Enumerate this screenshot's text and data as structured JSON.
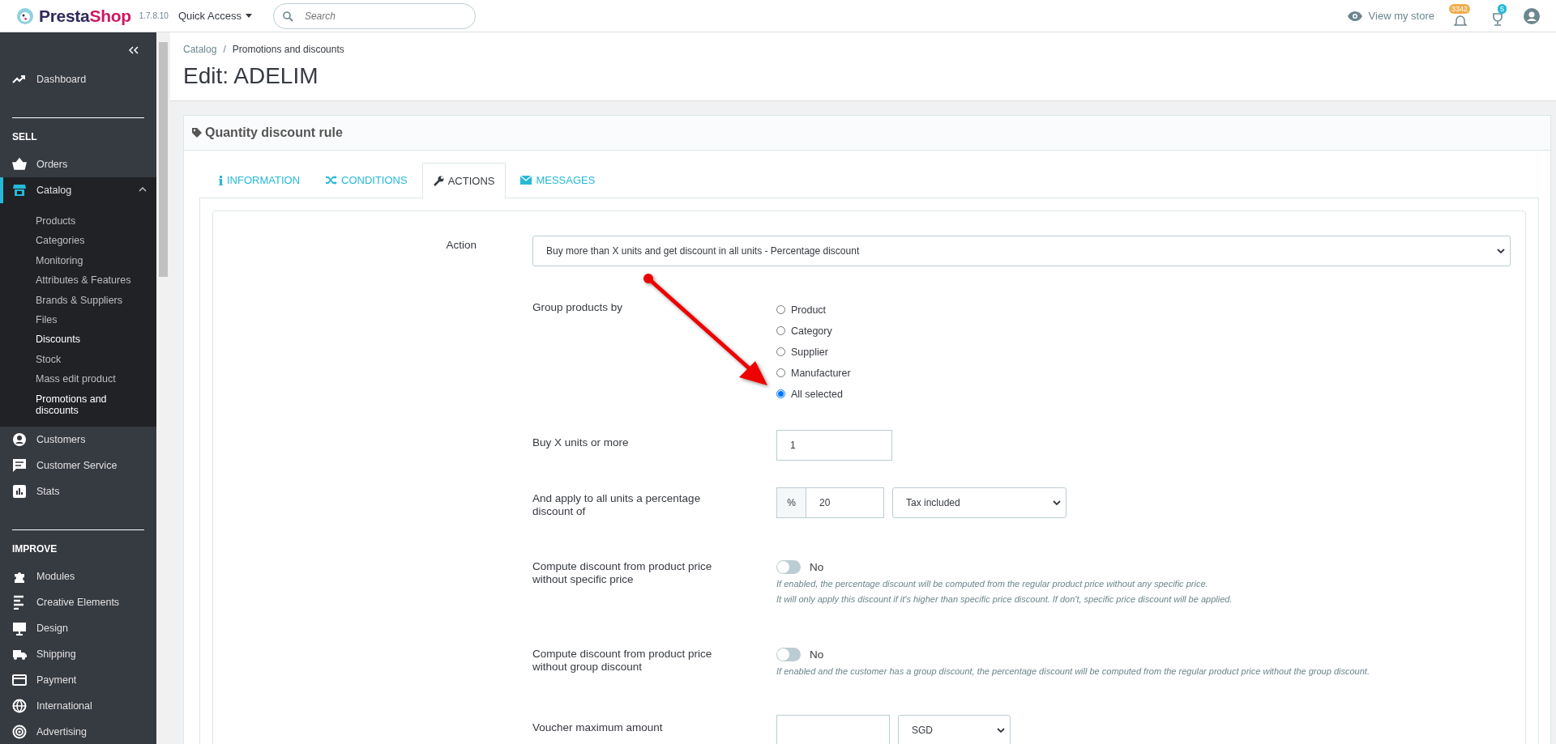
{
  "topbar": {
    "brand_parts": [
      "Presta",
      "Shop"
    ],
    "version": "1.7.8.10",
    "quick_access": "Quick Access",
    "search": {
      "placeholder": "Search"
    },
    "view_store": "View my store",
    "orders_badge": "3342",
    "trophy_badge": "5"
  },
  "sidebar": {
    "items": [
      {
        "kind": "link",
        "label": "Dashboard",
        "selected": false
      },
      {
        "kind": "heading",
        "label": "SELL"
      },
      {
        "kind": "link",
        "label": "Orders",
        "selected": false
      },
      {
        "kind": "link",
        "label": "Catalog",
        "selected": true,
        "expanded": true,
        "children": [
          {
            "label": "Products",
            "selected": false
          },
          {
            "label": "Categories",
            "selected": false
          },
          {
            "label": "Monitoring",
            "selected": false
          },
          {
            "label": "Attributes & Features",
            "selected": false
          },
          {
            "label": "Brands & Suppliers",
            "selected": false
          },
          {
            "label": "Files",
            "selected": false
          },
          {
            "label": "Discounts",
            "selected": true
          },
          {
            "label": "Stock",
            "selected": false
          },
          {
            "label": "Mass edit product",
            "selected": false
          },
          {
            "label": "Promotions and discounts",
            "selected": true
          }
        ]
      },
      {
        "kind": "link",
        "label": "Customers",
        "selected": false
      },
      {
        "kind": "link",
        "label": "Customer Service",
        "selected": false
      },
      {
        "kind": "link",
        "label": "Stats",
        "selected": false
      },
      {
        "kind": "heading",
        "label": "IMPROVE"
      },
      {
        "kind": "link",
        "label": "Modules",
        "selected": false
      },
      {
        "kind": "link",
        "label": "Creative Elements",
        "selected": false
      },
      {
        "kind": "link",
        "label": "Design",
        "selected": false
      },
      {
        "kind": "link",
        "label": "Shipping",
        "selected": false
      },
      {
        "kind": "link",
        "label": "Payment",
        "selected": false
      },
      {
        "kind": "link",
        "label": "International",
        "selected": false
      },
      {
        "kind": "link",
        "label": "Advertising",
        "selected": false
      }
    ]
  },
  "breadcrumb": {
    "items": [
      "Catalog",
      "Promotions and discounts"
    ],
    "separator": "/"
  },
  "page_title": "Edit: ADELIM",
  "panel": {
    "title": "Quantity discount rule",
    "tabs": [
      {
        "label": "INFORMATION",
        "selected": false
      },
      {
        "label": "CONDITIONS",
        "selected": false
      },
      {
        "label": "ACTIONS",
        "selected": true
      },
      {
        "label": "MESSAGES",
        "selected": false
      }
    ],
    "action": {
      "label": "Action",
      "value": "Buy more than X units and get discount in all units - Percentage discount"
    },
    "group_by": {
      "label": "Group products by",
      "options": [
        {
          "label": "Product",
          "selected": false
        },
        {
          "label": "Category",
          "selected": false
        },
        {
          "label": "Supplier",
          "selected": false
        },
        {
          "label": "Manufacturer",
          "selected": false
        },
        {
          "label": "All selected",
          "selected": true
        }
      ]
    },
    "buy_units": {
      "label": "Buy X units or more",
      "value": "1"
    },
    "percentage": {
      "label": "And apply to all units a percentage discount of",
      "addon": "%",
      "value": "20",
      "tax": "Tax included"
    },
    "toggles": [
      {
        "label": "Compute discount from product price without specific price",
        "on": false,
        "state_label": "No",
        "help": [
          "If enabled, the percentage discount will be computed from the regular product price without any specific price.",
          "It will only apply this discount if it's higher than specific price discount. If don't, specific price discount will be applied."
        ]
      },
      {
        "label": "Compute discount from product price without group discount",
        "on": false,
        "state_label": "No",
        "help": [
          "If enabled and the customer has a group discount, the percentage discount will be computed from the regular product price without the group discount."
        ]
      }
    ],
    "voucher_max": {
      "label": "Voucher maximum amount",
      "currency": "SGD"
    }
  }
}
